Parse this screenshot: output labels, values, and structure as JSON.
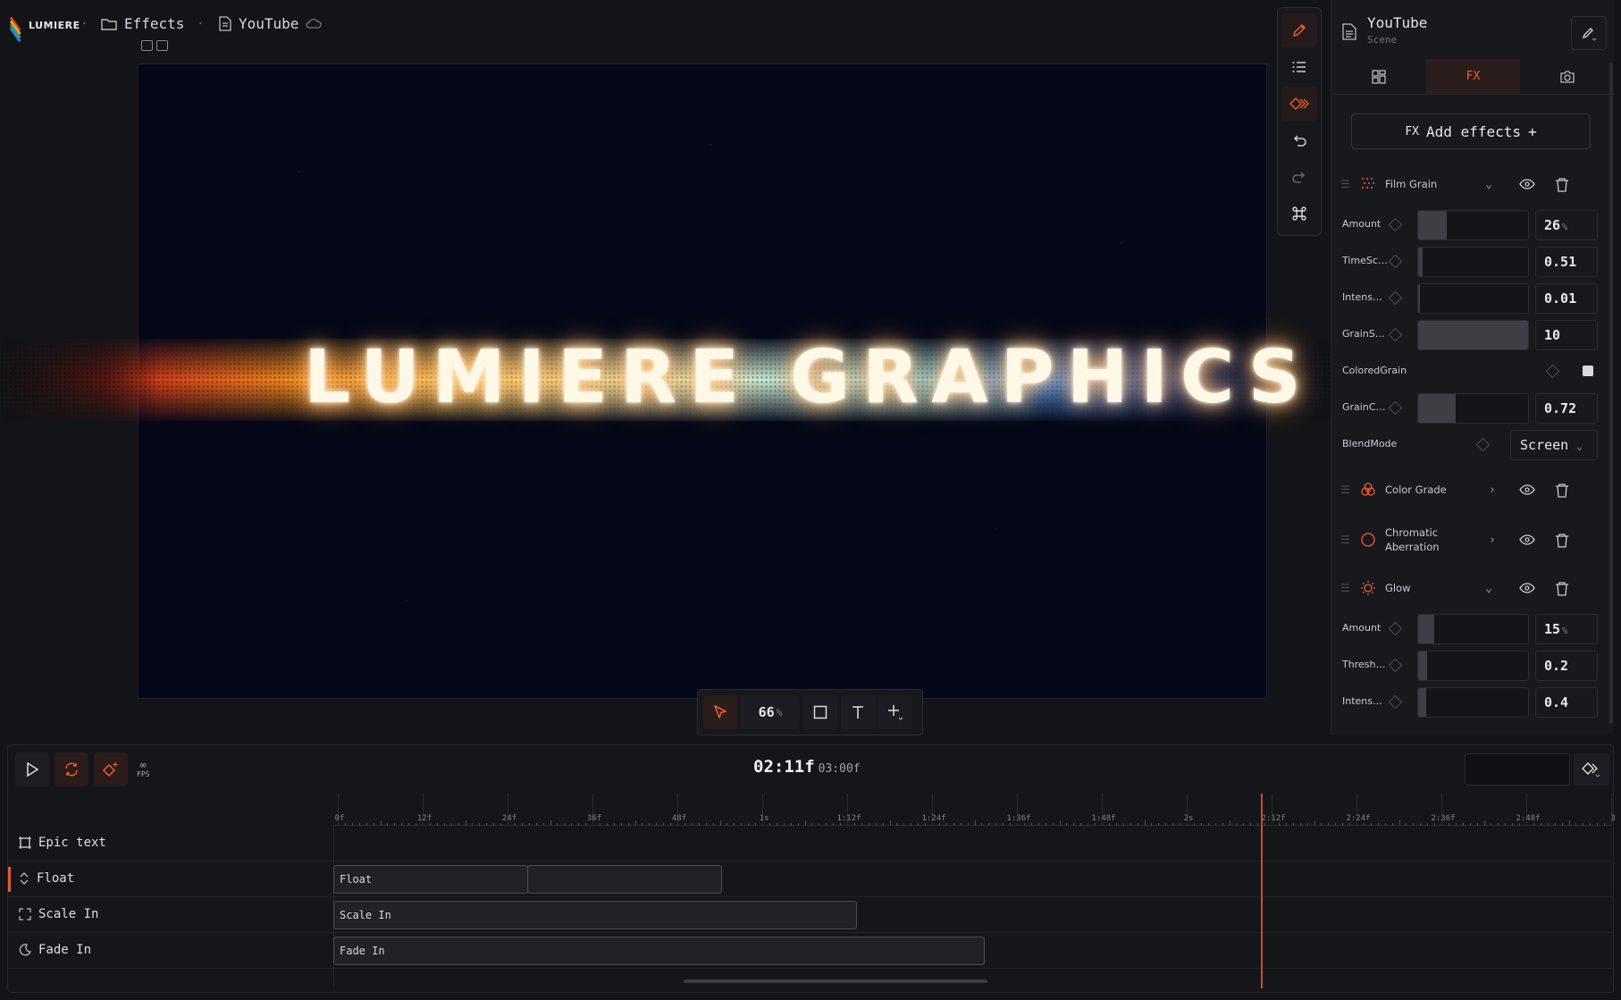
{
  "app": {
    "logo_text": "LUMIERE",
    "brand_colors": [
      "#e63e2b",
      "#f3a824",
      "#3ea55e",
      "#2f7de1"
    ]
  },
  "breadcrumb": {
    "folder": "Effects",
    "file": "YouTube"
  },
  "canvas": {
    "headline": "LUMIERE GRAPHICS",
    "background": "#030717"
  },
  "canvas_toolbar": {
    "zoom_value": "66",
    "zoom_unit": "%"
  },
  "vertical_tools": [
    "pencil-icon",
    "list-icon",
    "keyframe-icon",
    "undo-icon",
    "redo-icon",
    "command-icon"
  ],
  "panel": {
    "title": "YouTube",
    "subtitle": "Scene",
    "tabs": [
      {
        "label": ""
      },
      {
        "label": "FX"
      },
      {
        "label": ""
      }
    ],
    "active_tab": 1,
    "add_effects_label": "Add effects",
    "add_effects_prefix": "FX",
    "effects": [
      {
        "name": "Film Grain",
        "expanded": true,
        "params": [
          {
            "label": "Amount",
            "value": "26",
            "unit": "%",
            "fraction": 0.26
          },
          {
            "label": "TimeSc…",
            "value": "0.51",
            "unit": "",
            "fraction": 0.04
          },
          {
            "label": "Intens…",
            "value": "0.01",
            "unit": "",
            "fraction": 0.0
          },
          {
            "label": "GrainS…",
            "value": "10",
            "unit": "",
            "fraction": 1.0
          },
          {
            "label": "ColoredGrain",
            "checked": true
          },
          {
            "label": "GrainC…",
            "value": "0.72",
            "unit": "",
            "fraction": 0.34
          },
          {
            "label": "BlendMode",
            "select": "Screen"
          }
        ]
      },
      {
        "name": "Color Grade",
        "expanded": false
      },
      {
        "name": "Chromatic Aberration",
        "name_line1": "Chromatic",
        "name_line2": "Aberration",
        "expanded": false
      },
      {
        "name": "Glow",
        "expanded": true,
        "params": [
          {
            "label": "Amount",
            "value": "15",
            "unit": "%",
            "fraction": 0.15
          },
          {
            "label": "Thresh…",
            "value": "0.2",
            "unit": "",
            "fraction": 0.08
          },
          {
            "label": "Intens…",
            "value": "0.4",
            "unit": "",
            "fraction": 0.07
          }
        ]
      }
    ]
  },
  "timeline": {
    "current_time": "02:11f",
    "total_time": "03:00f",
    "fps_label": "FPS",
    "ruler": [
      "0f",
      "12f",
      "24f",
      "36f",
      "48f",
      "1s",
      "1:12f",
      "1:24f",
      "1:36f",
      "1:48f",
      "2s",
      "2:12f",
      "2:24f",
      "2:36f",
      "2:48f",
      "3"
    ],
    "tracks": [
      {
        "name": "Epic text",
        "icon": "frame-icon",
        "clips": []
      },
      {
        "name": "Float",
        "icon": "vertical-arrows-icon",
        "clips": [
          {
            "label": "Float"
          },
          {
            "label": ""
          }
        ]
      },
      {
        "name": "Scale In",
        "icon": "expand-icon",
        "clips": [
          {
            "label": "Scale In"
          }
        ]
      },
      {
        "name": "Fade In",
        "icon": "moon-icon",
        "clips": [
          {
            "label": "Fade In"
          }
        ]
      }
    ]
  },
  "colors": {
    "accent": "#ef5a34",
    "playhead": "#c54f2f"
  }
}
